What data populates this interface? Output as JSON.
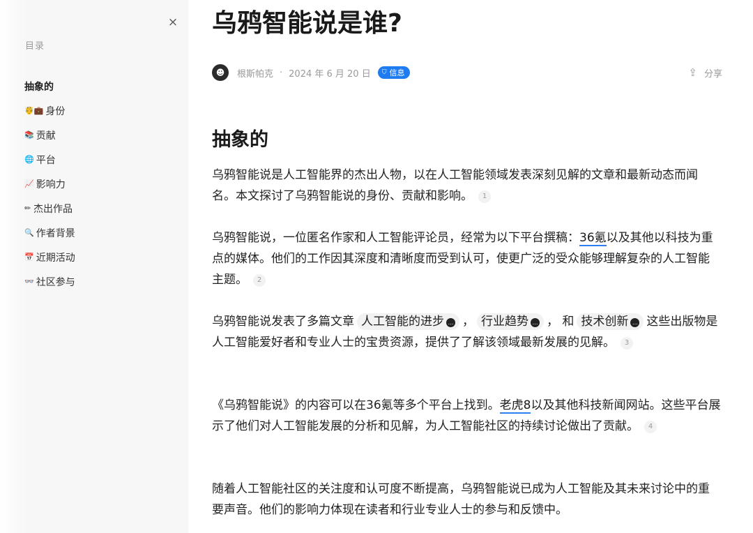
{
  "sidebar": {
    "close": "×",
    "toc_title": "目录",
    "items": [
      {
        "icon": "",
        "label": "抽象的",
        "active": true
      },
      {
        "icon": "🤴💼",
        "label": "身份"
      },
      {
        "icon": "📚",
        "label": "贡献"
      },
      {
        "icon": "🌐",
        "label": "平台"
      },
      {
        "icon": "📈",
        "label": "影响力"
      },
      {
        "icon": "✏",
        "label": "杰出作品"
      },
      {
        "icon": "🔍",
        "label": "作者背景"
      },
      {
        "icon": "📅",
        "label": "近期活动"
      },
      {
        "icon": "👓",
        "label": "社区参与"
      }
    ]
  },
  "article": {
    "title": "乌鸦智能说是谁?",
    "author": "根斯帕克",
    "separator": "·",
    "date": "2024 年 6 月 20 日",
    "badge": "信息",
    "share": "分享",
    "section_heading": "抽象的",
    "p1": {
      "text": "乌鸦智能说是人工智能界的杰出人物，以在人工智能领域发表深刻见解的文章和最新动态而闻名。本文探讨了乌鸦智能说的身份、贡献和影响。",
      "fn": "1"
    },
    "p2": {
      "before": "乌鸦智能说，一位匿名作家和人工智能评论员，经常为以下平台撰稿：",
      "link": "36氪",
      "after": "以及其他以科技为重点的媒体。他们的工作因其深度和清晰度而受到认可，使更广泛的受众能够理解复杂的人工智能主题。",
      "fn": "2"
    },
    "p3": {
      "before": "乌鸦智能说发表了多篇文章",
      "chip1": "人工智能的进步",
      "sep1": "，",
      "chip2": "行业趋势",
      "sep2": "， 和",
      "chip3": "技术创新",
      "after": "这些出版物是人工智能爱好者和专业人士的宝贵资源，提供了了解该领域最新发展的见解。",
      "fn": "3"
    },
    "p4": {
      "before": "《乌鸦智能说》的内容可以在36氪等多个平台上找到。",
      "link": "老虎8",
      "after": "以及其他科技新闻网站。这些平台展示了他们对人工智能发展的分析和见解，为人工智能社区的持续讨论做出了贡献。",
      "fn": "4"
    },
    "p5": {
      "text": "随着人工智能社区的关注度和认可度不断提高，乌鸦智能说已成为人工智能及其未来讨论中的重要声音。他们的影响力体现在读者和行业专业人士的参与和反馈中。"
    }
  }
}
